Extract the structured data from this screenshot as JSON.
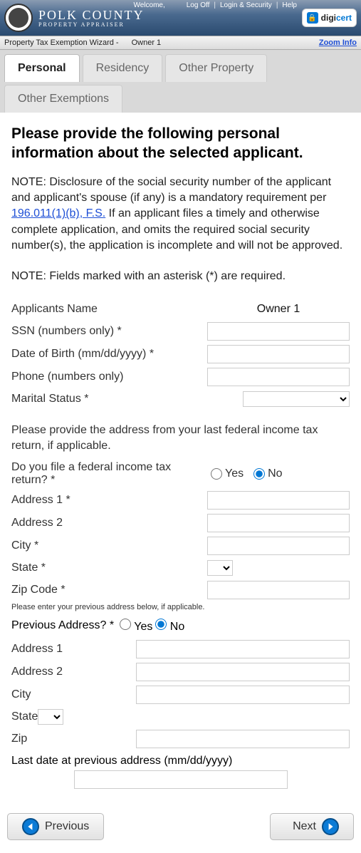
{
  "header": {
    "brand_main": "POLK COUNTY",
    "brand_sub": "PROPERTY APPRAISER",
    "welcome": "Welcome,",
    "links": {
      "logoff": "Log Off",
      "loginsec": "Login & Security",
      "help": "Help"
    },
    "digicert_brand": "digi",
    "digicert_brand2": "cert"
  },
  "wizardbar": {
    "title": "Property Tax Exemption Wizard -",
    "owner": "Owner 1",
    "zoom": "Zoom Info"
  },
  "tabs": {
    "personal": "Personal",
    "residency": "Residency",
    "other_property": "Other Property",
    "other_exemptions": "Other Exemptions"
  },
  "heading": "Please provide the following personal information about the selected applicant.",
  "note1_pre": "NOTE: Disclosure of the social security number of the applicant and applicant's spouse (if any) is a mandatory requirement per ",
  "note1_link": "196.011(1)(b), F.S.",
  "note1_post": " If an applicant files a timely and otherwise complete application, and omits the required social security number(s), the application is incomplete and will not be approved.",
  "note2": "NOTE: Fields marked with an asterisk (*) are required.",
  "fields": {
    "applicants_name_label": "Applicants Name",
    "applicants_name_value": "Owner 1",
    "ssn_label": "SSN (numbers only) *",
    "dob_label": "Date of Birth (mm/dd/yyyy) *",
    "phone_label": "Phone (numbers only)",
    "marital_label": "Marital Status *"
  },
  "federal_text": "Please provide the address from your last federal income tax return, if applicable.",
  "federal_q": "Do you file a federal income tax return? *",
  "yes": "Yes",
  "no": "No",
  "addr": {
    "a1": "Address 1 *",
    "a2": "Address 2",
    "city": "City *",
    "state": "State *",
    "zip": "Zip Code *"
  },
  "prev_note": "Please enter your previous address below, if applicable.",
  "prev_q": "Previous Address? *",
  "prev": {
    "a1": "Address 1",
    "a2": "Address 2",
    "city": "City",
    "state": "State",
    "zip": "Zip"
  },
  "last_date_label": "Last date at previous address (mm/dd/yyyy)",
  "nav": {
    "prev": "Previous",
    "next": "Next"
  }
}
